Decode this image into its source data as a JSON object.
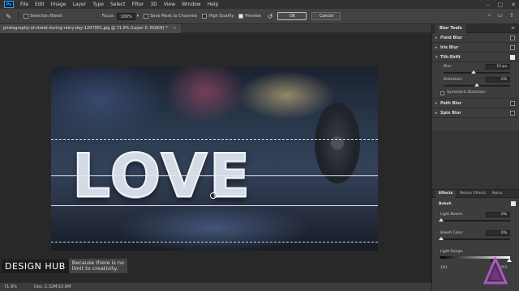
{
  "app": {
    "logo_text": "Ps"
  },
  "menu": [
    "File",
    "Edit",
    "Image",
    "Layer",
    "Type",
    "Select",
    "Filter",
    "3D",
    "View",
    "Window",
    "Help"
  ],
  "window_controls": [
    "–",
    "□",
    "✕"
  ],
  "options_bar": {
    "selection_bleed_label": "Selection Bleed:",
    "focus_label": "Focus:",
    "focus_value": "100%",
    "save_mask_label": "Save Mask to Channels",
    "save_mask_checked": false,
    "high_quality_label": "High Quality",
    "high_quality_checked": false,
    "preview_label": "Preview",
    "preview_checked": true,
    "ok_label": "OK",
    "cancel_label": "Cancel"
  },
  "document": {
    "tab_title": "photography-of-street-during-rainy-day-1207951.jpg @ 71.9% (Layer 0, RGB/8) *",
    "love_text": "LOVE"
  },
  "status": {
    "zoom": "71.9%",
    "doc_size": "Doc: 2.32M/10.6M"
  },
  "watermark": {
    "brand": "DESIGN HUB",
    "tagline_line1": "Because there is no",
    "tagline_line2": "limit to creativity."
  },
  "blur_tools": {
    "panel_title": "Blur Tools",
    "items": [
      {
        "label": "Field Blur",
        "checked": false,
        "expanded": false
      },
      {
        "label": "Iris Blur",
        "checked": false,
        "expanded": false
      },
      {
        "label": "Tilt-Shift",
        "checked": true,
        "expanded": true
      },
      {
        "label": "Path Blur",
        "checked": false,
        "expanded": false
      },
      {
        "label": "Spin Blur",
        "checked": false,
        "expanded": false
      }
    ],
    "tilt_shift": {
      "blur_label": "Blur:",
      "blur_value": "15 px",
      "blur_fraction": 0.45,
      "distortion_label": "Distortion:",
      "distortion_value": "0%",
      "distortion_fraction": 0.5,
      "symmetric_label": "Symmetric Distortion",
      "symmetric_checked": false
    }
  },
  "effects": {
    "tabs": [
      "Effects",
      "Motion Effects",
      "Noise"
    ],
    "active_tab": "Effects",
    "bokeh_label": "Bokeh",
    "bokeh_checked": true,
    "light_bokeh_label": "Light Bokeh:",
    "light_bokeh_value": "0%",
    "bokeh_color_label": "Bokeh Color:",
    "bokeh_color_value": "0%",
    "light_range_label": "Light Range:",
    "light_range_min": "191",
    "light_range_max": "255"
  },
  "colors": {
    "accent_blue": "#31a8ff",
    "panel_bg": "#3d3d3d",
    "canvas_bg": "#282828"
  }
}
